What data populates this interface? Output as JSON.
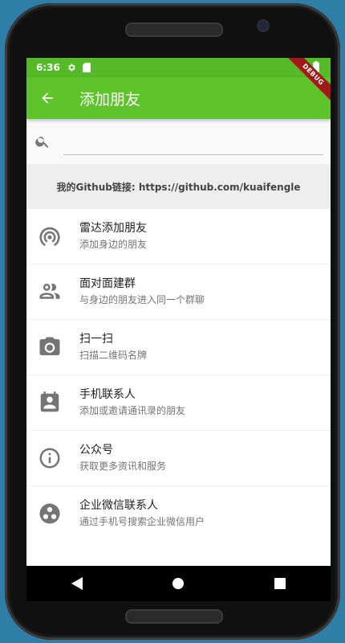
{
  "status": {
    "time": "6:36"
  },
  "debug_label": "DEBUG",
  "appbar": {
    "title": "添加朋友"
  },
  "search": {
    "placeholder": ""
  },
  "github": {
    "text": "我的Github链接: https://github.com/kuaifengle"
  },
  "items": [
    {
      "icon": "radar-icon",
      "title": "雷达添加朋友",
      "subtitle": "添加身边的朋友"
    },
    {
      "icon": "people-icon",
      "title": "面对面建群",
      "subtitle": "与身边的朋友进入同一个群聊"
    },
    {
      "icon": "camera-icon",
      "title": "扫一扫",
      "subtitle": "扫描二维码名牌"
    },
    {
      "icon": "contacts-icon",
      "title": "手机联系人",
      "subtitle": "添加或邀请通讯录的朋友"
    },
    {
      "icon": "info-icon",
      "title": "公众号",
      "subtitle": "获取更多资讯和服务"
    },
    {
      "icon": "workspaces-icon",
      "title": "企业微信联系人",
      "subtitle": "通过手机号搜索企业微信用户"
    }
  ],
  "colors": {
    "primary": "#5fc32a",
    "statusbar": "#55b928",
    "icon": "#757575"
  }
}
